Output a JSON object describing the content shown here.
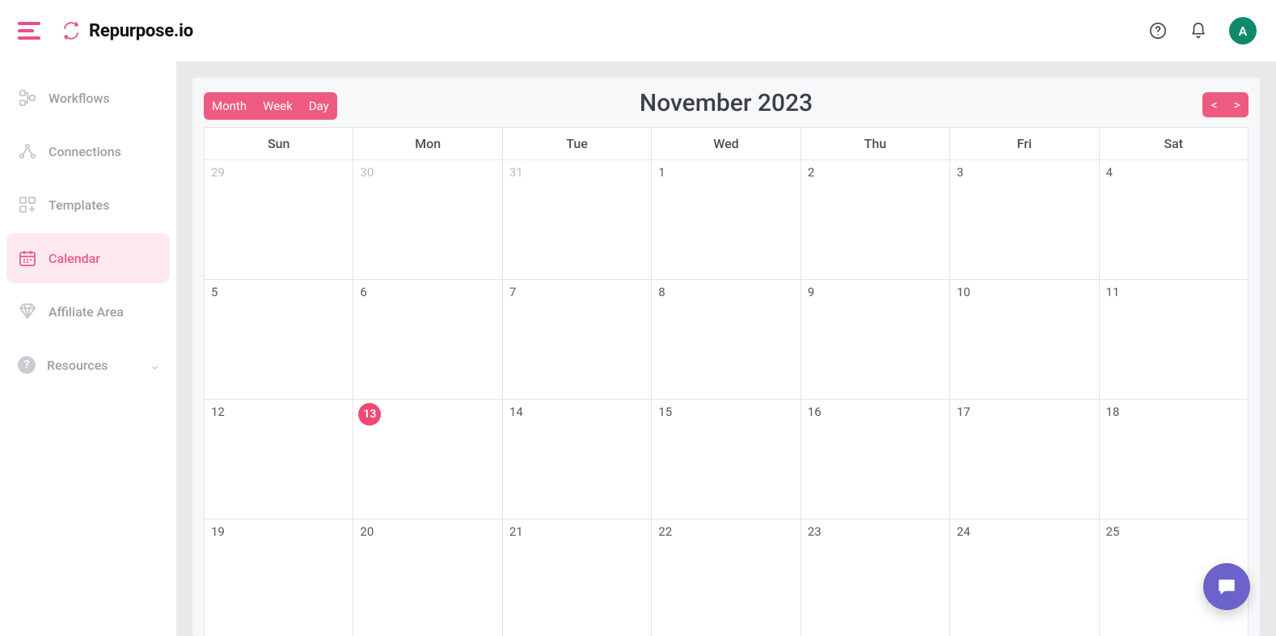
{
  "brand": {
    "name": "Repurpose.io"
  },
  "user": {
    "avatar_initial": "A"
  },
  "sidebar": {
    "items": [
      {
        "label": "Workflows"
      },
      {
        "label": "Connections"
      },
      {
        "label": "Templates"
      },
      {
        "label": "Calendar"
      },
      {
        "label": "Affiliate Area"
      },
      {
        "label": "Resources"
      }
    ]
  },
  "calendar": {
    "title": "November 2023",
    "view_buttons": {
      "month": "Month",
      "week": "Week",
      "day": "Day"
    },
    "nav": {
      "prev": "<",
      "next": ">"
    },
    "day_headers": [
      "Sun",
      "Mon",
      "Tue",
      "Wed",
      "Thu",
      "Fri",
      "Sat"
    ],
    "today": 13,
    "weeks": [
      [
        {
          "n": "29",
          "other": true
        },
        {
          "n": "30",
          "other": true
        },
        {
          "n": "31",
          "other": true
        },
        {
          "n": "1"
        },
        {
          "n": "2"
        },
        {
          "n": "3"
        },
        {
          "n": "4"
        }
      ],
      [
        {
          "n": "5"
        },
        {
          "n": "6"
        },
        {
          "n": "7"
        },
        {
          "n": "8"
        },
        {
          "n": "9"
        },
        {
          "n": "10"
        },
        {
          "n": "11"
        }
      ],
      [
        {
          "n": "12"
        },
        {
          "n": "13",
          "today": true
        },
        {
          "n": "14"
        },
        {
          "n": "15"
        },
        {
          "n": "16"
        },
        {
          "n": "17"
        },
        {
          "n": "18"
        }
      ],
      [
        {
          "n": "19"
        },
        {
          "n": "20"
        },
        {
          "n": "21"
        },
        {
          "n": "22"
        },
        {
          "n": "23"
        },
        {
          "n": "24"
        },
        {
          "n": "25"
        }
      ]
    ]
  }
}
